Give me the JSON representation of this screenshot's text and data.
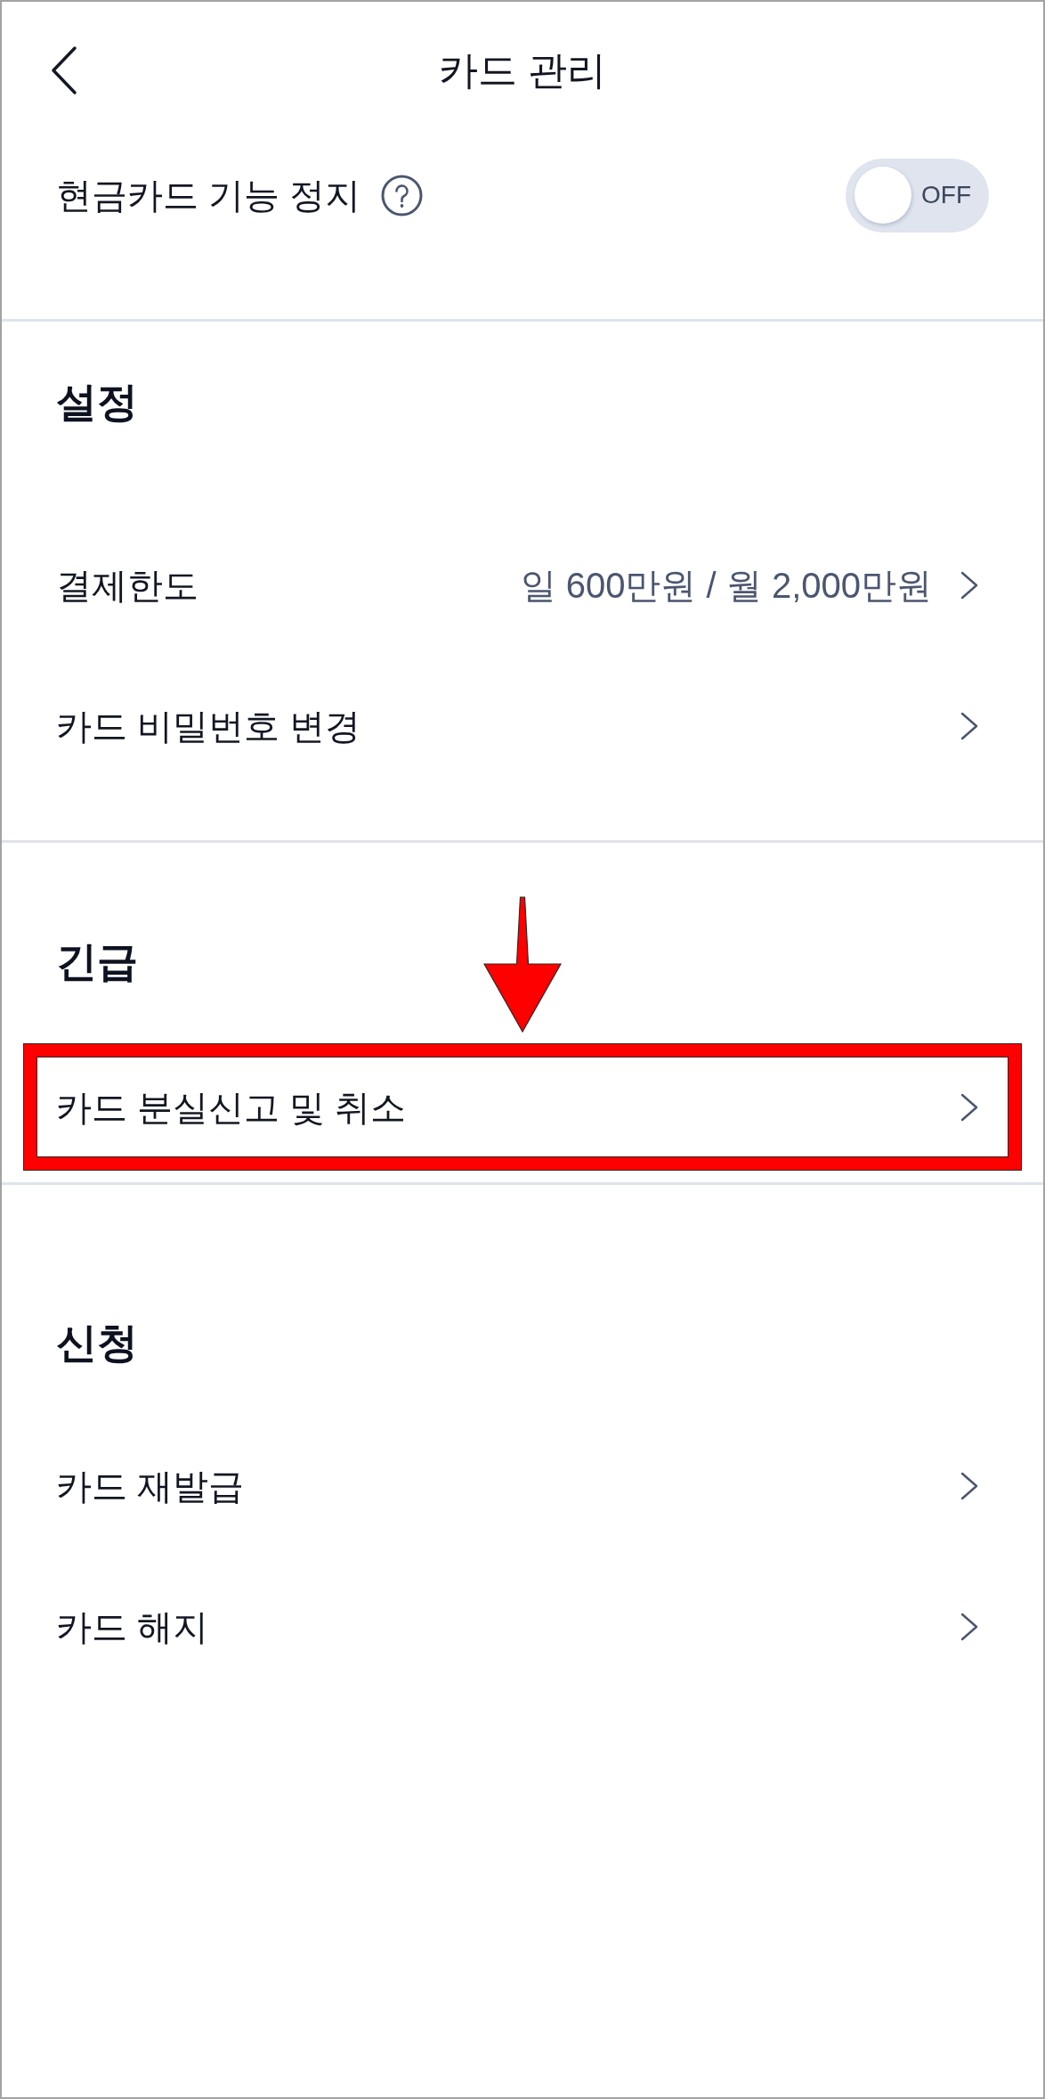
{
  "header": {
    "title": "카드 관리"
  },
  "cash_card_stop": {
    "label": "현금카드 기능 정지",
    "toggle": {
      "on": false,
      "label": "OFF"
    }
  },
  "sections": [
    {
      "heading": "설정",
      "items": [
        {
          "label": "결제한도",
          "value": "일 600만원 / 월 2,000만원",
          "highlighted": false
        },
        {
          "label": "카드 비밀번호 변경",
          "highlighted": false
        }
      ]
    },
    {
      "heading": "긴급",
      "items": [
        {
          "label": "카드 분실신고 및 취소",
          "highlighted": true
        }
      ]
    },
    {
      "heading": "신청",
      "items": [
        {
          "label": "카드 재발급",
          "highlighted": false
        },
        {
          "label": "카드 해지",
          "highlighted": false
        }
      ]
    }
  ]
}
